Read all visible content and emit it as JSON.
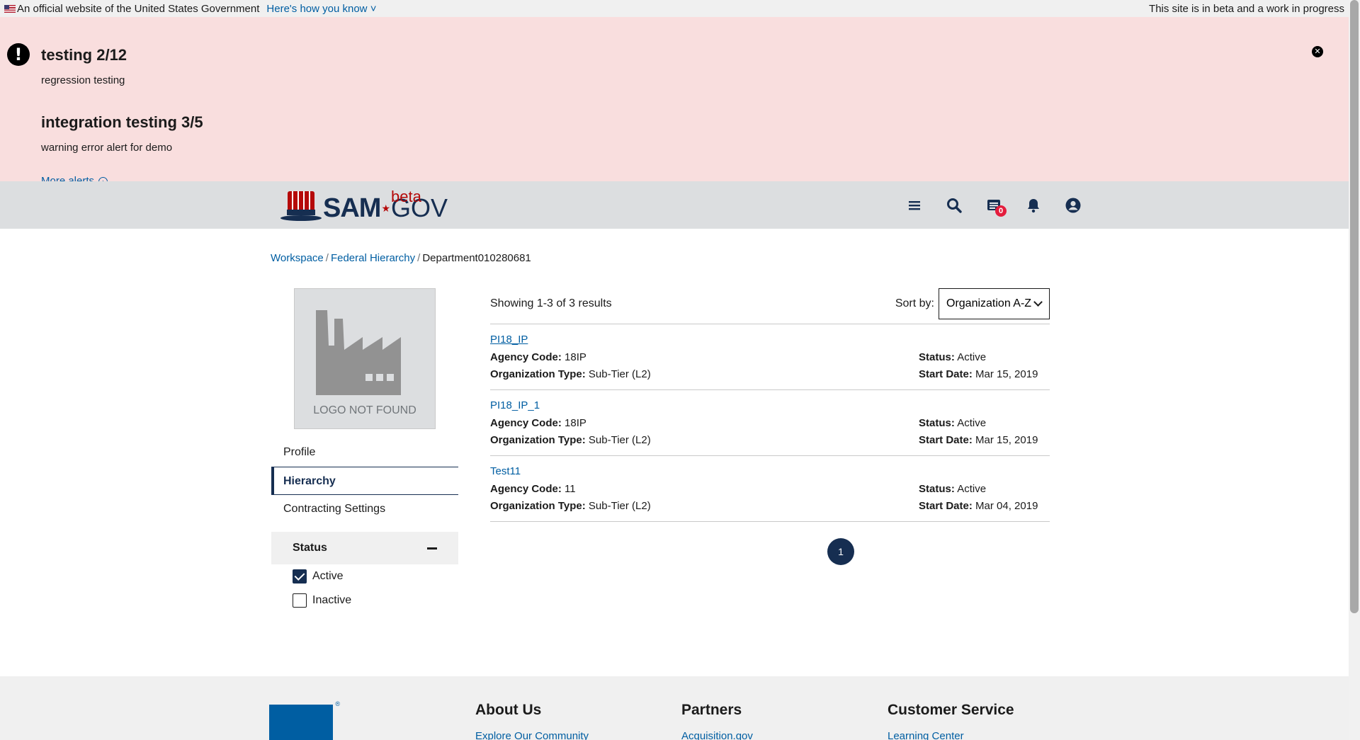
{
  "gov_banner": {
    "official_text": "An official website of the United States Government",
    "how_you_know": "Here's how you know",
    "beta_note": "This site is in beta and a work in progress"
  },
  "alerts": {
    "items": [
      {
        "title": "testing 2/12",
        "body": "regression testing"
      },
      {
        "title": "integration testing 3/5",
        "body": "warning error alert for demo"
      }
    ],
    "more_label": "More alerts"
  },
  "header": {
    "logo_sam": "SAM",
    "logo_gov": "GOV",
    "logo_beta": "beta",
    "message_count": "0",
    "icons": [
      "menu-icon",
      "search-icon",
      "messages-icon",
      "bell-icon",
      "user-icon"
    ]
  },
  "breadcrumb": {
    "items": [
      "Workspace",
      "Federal Hierarchy"
    ],
    "current": "Department010280681"
  },
  "org_logo": {
    "placeholder": "LOGO NOT FOUND"
  },
  "side_nav": {
    "items": [
      "Profile",
      "Hierarchy",
      "Contracting Settings"
    ],
    "active": "Hierarchy"
  },
  "filter": {
    "title": "Status",
    "options": [
      {
        "label": "Active",
        "checked": true
      },
      {
        "label": "Inactive",
        "checked": false
      }
    ]
  },
  "results": {
    "showing": "Showing 1-3 of 3 results",
    "sort_label": "Sort by:",
    "sort_value": "Organization A-Z",
    "items": [
      {
        "name": "PI18_IP",
        "agency_code_label": "Agency Code:",
        "agency_code": "18IP",
        "org_type_label": "Organization Type:",
        "org_type": "Sub-Tier (L2)",
        "status_label": "Status:",
        "status": "Active",
        "start_date_label": "Start Date:",
        "start_date": "Mar 15, 2019"
      },
      {
        "name": "PI18_IP_1",
        "agency_code_label": "Agency Code:",
        "agency_code": "18IP",
        "org_type_label": "Organization Type:",
        "org_type": "Sub-Tier (L2)",
        "status_label": "Status:",
        "status": "Active",
        "start_date_label": "Start Date:",
        "start_date": "Mar 15, 2019"
      },
      {
        "name": "Test11",
        "agency_code_label": "Agency Code:",
        "agency_code": "11",
        "org_type_label": "Organization Type:",
        "org_type": "Sub-Tier (L2)",
        "status_label": "Status:",
        "status": "Active",
        "start_date_label": "Start Date:",
        "start_date": "Mar 04, 2019"
      }
    ],
    "current_page": "1"
  },
  "footer": {
    "columns": [
      {
        "title": "About Us",
        "link": "Explore Our Community"
      },
      {
        "title": "Partners",
        "link": "Acquisition.gov"
      },
      {
        "title": "Customer Service",
        "link": "Learning Center"
      }
    ]
  },
  "colors": {
    "alert_bg": "#f9dede",
    "header_bg": "#dcdee0",
    "navy": "#162e51",
    "link": "#005ea2",
    "brand_red": "#b50909"
  }
}
